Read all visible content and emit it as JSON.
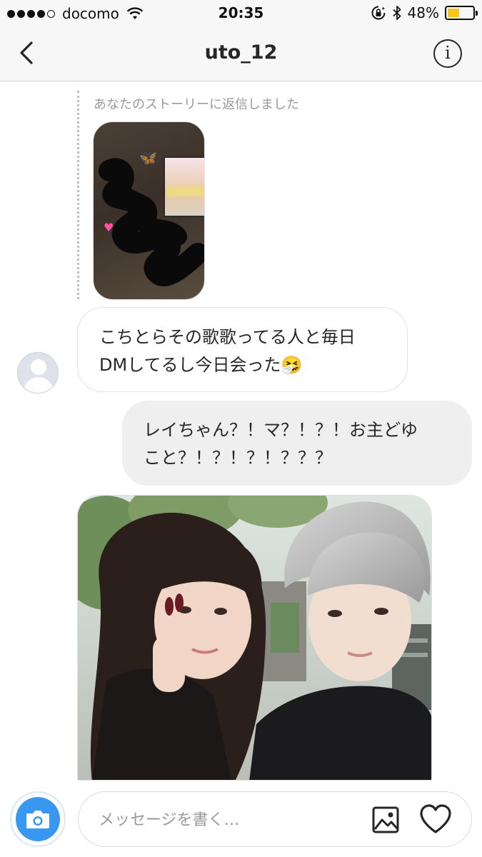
{
  "status_bar": {
    "carrier": "docomo",
    "time": "20:35",
    "battery_percent": "48%",
    "battery_level": 0.48,
    "signal_bars_filled": 4,
    "signal_bars_total": 5
  },
  "header": {
    "title": "uto_12",
    "back_icon": "chevron-left-icon",
    "info_icon": "info-circle-icon",
    "info_glyph": "i"
  },
  "messages": {
    "story_reply_label": "あなたのストーリーに返信しました",
    "incoming_line1": "こちとらその歌歌ってる人と毎日",
    "incoming_line2": "DMしてるし今日会った🤧",
    "outgoing_line1": "レイちゃん？！マ？！？！お主どゆ",
    "outgoing_line2": "こと？！？！？！？？？"
  },
  "composer": {
    "placeholder": "メッセージを書く…",
    "camera_icon": "camera-icon",
    "gallery_icon": "image-gallery-icon",
    "heart_icon": "heart-icon"
  },
  "colors": {
    "accent": "#3897f0",
    "battery": "#f5c518",
    "outgoing_bubble": "#efefef",
    "muted_text": "#999999"
  }
}
